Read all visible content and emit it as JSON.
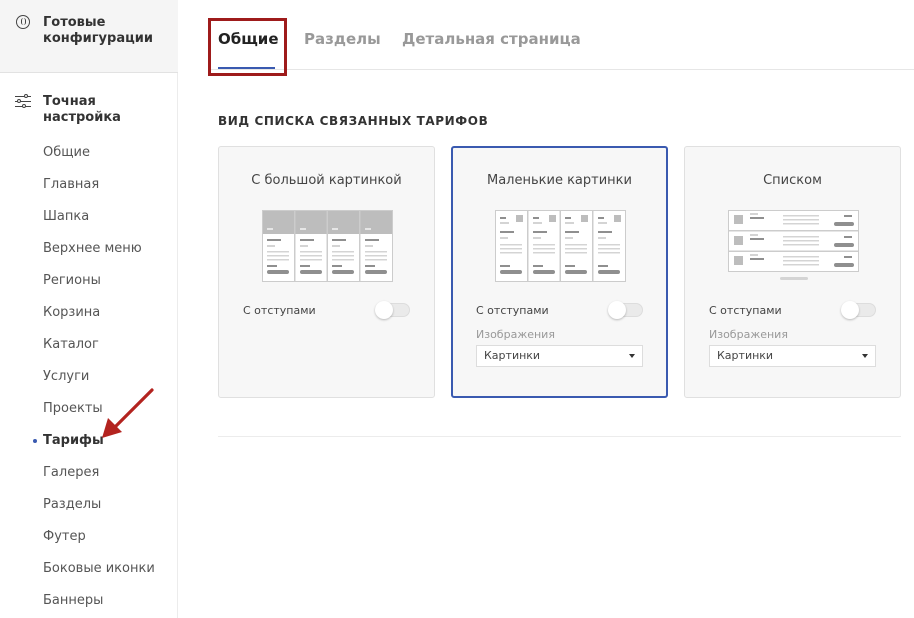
{
  "sidebar": {
    "ready_configs": "Готовые конфигурации",
    "fine_tuning": "Точная настройка",
    "items": [
      {
        "label": "Общие"
      },
      {
        "label": "Главная"
      },
      {
        "label": "Шапка"
      },
      {
        "label": "Верхнее меню"
      },
      {
        "label": "Регионы"
      },
      {
        "label": "Корзина"
      },
      {
        "label": "Каталог"
      },
      {
        "label": "Услуги"
      },
      {
        "label": "Проекты"
      },
      {
        "label": "Тарифы",
        "active": true
      },
      {
        "label": "Галерея"
      },
      {
        "label": "Разделы"
      },
      {
        "label": "Футер"
      },
      {
        "label": "Боковые иконки"
      },
      {
        "label": "Баннеры"
      }
    ],
    "active_item": "Тарифы"
  },
  "tabs": {
    "items": [
      "Общие",
      "Разделы",
      "Детальная страница"
    ],
    "active": "Общие"
  },
  "section": {
    "title": "ВИД СПИСКА СВЯЗАННЫХ ТАРИФОВ",
    "cards": [
      {
        "title": "С большой картинкой",
        "option_label": "С отступами",
        "option_on": false
      },
      {
        "title": "Маленькие картинки",
        "option_label": "С отступами",
        "option_on": false,
        "images_label": "Изображения",
        "images_value": "Картинки",
        "selected": true
      },
      {
        "title": "Списком",
        "option_label": "С отступами",
        "option_on": false,
        "images_label": "Изображения",
        "images_value": "Картинки"
      }
    ]
  },
  "colors": {
    "accent": "#3a5ab0",
    "highlight": "#9e1b1b",
    "arrow": "#b3231f"
  },
  "icons": [
    "ready-config-icon",
    "sliders-icon",
    "select-caret-icon",
    "arrow-annotation"
  ]
}
